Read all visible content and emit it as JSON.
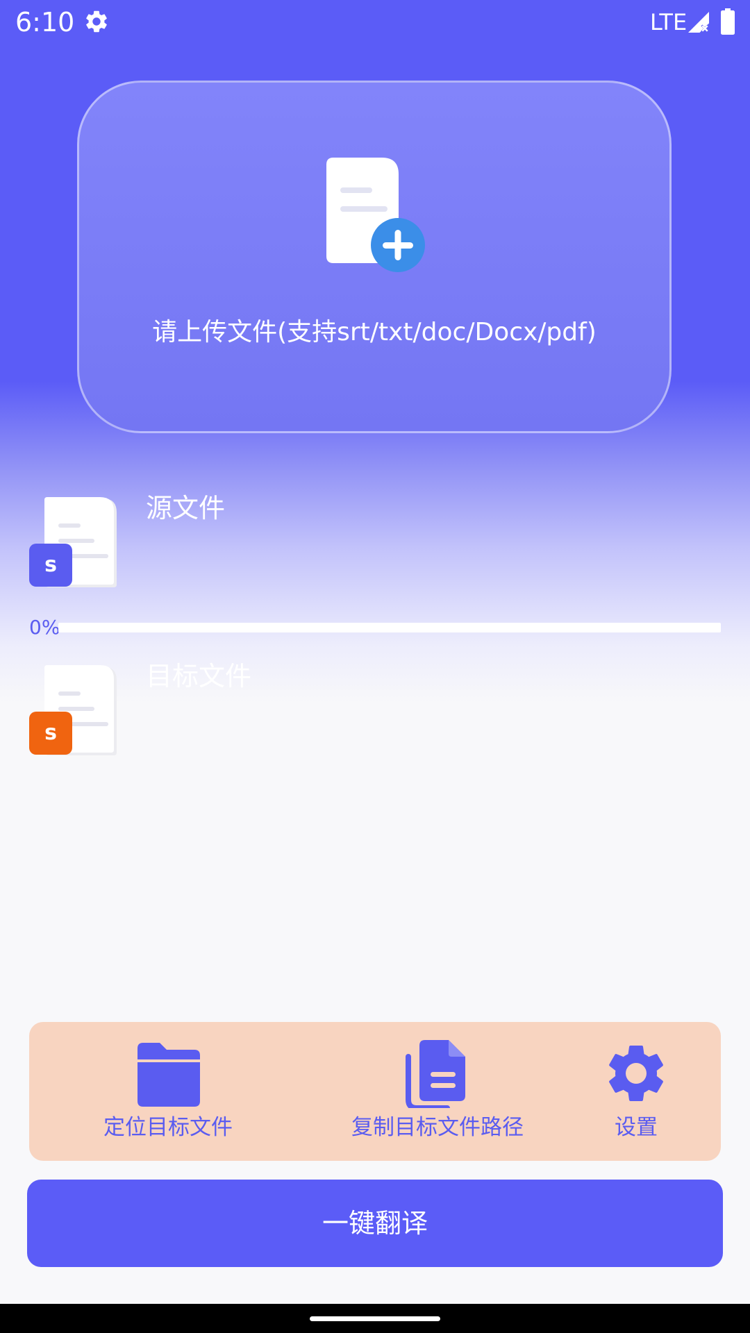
{
  "status_bar": {
    "time": "6:10",
    "network": "LTE",
    "icons": [
      "gear-icon",
      "signal-icon",
      "battery-icon"
    ]
  },
  "upload": {
    "text": "请上传文件(支持srt/txt/doc/Docx/pdf)",
    "icon": "add-file-icon"
  },
  "source_file": {
    "label": "源文件",
    "badge": "s",
    "badge_color": "#5a5cf0"
  },
  "target_file": {
    "label": "目标文件",
    "badge": "s",
    "badge_color": "#f06410"
  },
  "progress": {
    "percent_text": "0%",
    "value": 0
  },
  "toolbar": {
    "locate_label": "定位目标文件",
    "copy_path_label": "复制目标文件路径",
    "settings_label": "设置"
  },
  "translate_button": {
    "label": "一键翻译"
  },
  "colors": {
    "primary": "#5b5cf7",
    "toolbar_bg": "#f8d4c0",
    "accent_blue": "#3b8ee8"
  }
}
